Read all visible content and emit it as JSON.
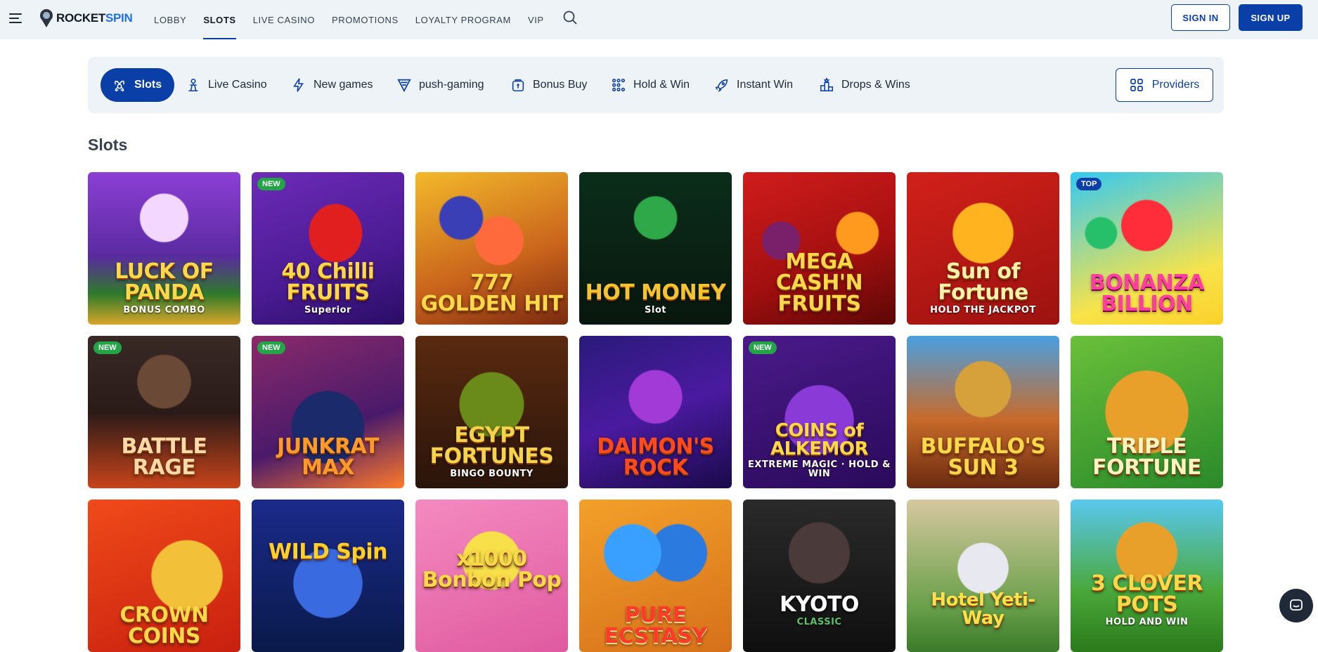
{
  "brand": {
    "part1": "ROCKET",
    "part2": "SPIN"
  },
  "nav": [
    {
      "label": "Lobby",
      "active": false
    },
    {
      "label": "Slots",
      "active": true
    },
    {
      "label": "Live Casino",
      "active": false
    },
    {
      "label": "Promotions",
      "active": false
    },
    {
      "label": "Loyalty Program",
      "active": false
    },
    {
      "label": "VIP",
      "active": false
    }
  ],
  "auth": {
    "signin": "SIGN IN",
    "signup": "SIGN UP"
  },
  "categories": [
    {
      "label": "Slots",
      "icon": "slots-icon"
    },
    {
      "label": "Live Casino",
      "icon": "live-casino-icon"
    },
    {
      "label": "New games",
      "icon": "lightning-icon"
    },
    {
      "label": "push-gaming",
      "icon": "push-gaming-icon"
    },
    {
      "label": "Bonus Buy",
      "icon": "bonus-buy-icon"
    },
    {
      "label": "Hold & Win",
      "icon": "hold-win-icon"
    },
    {
      "label": "Instant Win",
      "icon": "rocket-icon"
    },
    {
      "label": "Drops & Wins",
      "icon": "drops-wins-icon"
    }
  ],
  "providers_label": "Providers",
  "section_title": "Slots",
  "games": [
    {
      "title": "LUCK OF PANDA",
      "sub": "BONUS COMBO",
      "badge": ""
    },
    {
      "title": "40 Chilli FRUITS",
      "sub": "Superior",
      "badge": "NEW"
    },
    {
      "title": "777 GOLDEN HIT",
      "sub": "",
      "badge": ""
    },
    {
      "title": "HOT MONEY",
      "sub": "Slot",
      "badge": ""
    },
    {
      "title": "MEGA CASH'N FRUITS",
      "sub": "",
      "badge": ""
    },
    {
      "title": "Sun of Fortune",
      "sub": "HOLD THE JACKPOT",
      "badge": ""
    },
    {
      "title": "BONANZA BILLION",
      "sub": "",
      "badge": "TOP"
    },
    {
      "title": "BATTLE RAGE",
      "sub": "",
      "badge": "NEW"
    },
    {
      "title": "JUNKRAT MAX",
      "sub": "",
      "badge": "NEW"
    },
    {
      "title": "EGYPT FORTUNES",
      "sub": "BINGO BOUNTY",
      "badge": ""
    },
    {
      "title": "DAIMON'S ROCK",
      "sub": "",
      "badge": ""
    },
    {
      "title": "COINS of ALKEMOR",
      "sub": "EXTREME MAGIC · HOLD & WIN",
      "badge": "NEW"
    },
    {
      "title": "BUFFALO'S SUN 3",
      "sub": "",
      "badge": ""
    },
    {
      "title": "TRIPLE FORTUNE",
      "sub": "",
      "badge": ""
    },
    {
      "title": "CROWN COINS",
      "sub": "",
      "badge": ""
    },
    {
      "title": "WILD Spin",
      "sub": "",
      "badge": ""
    },
    {
      "title": "x1000 Bonbon Pop",
      "sub": "",
      "badge": ""
    },
    {
      "title": "PURE ECSTASY",
      "sub": "",
      "badge": ""
    },
    {
      "title": "KYOTO",
      "sub": "CLASSIC",
      "badge": ""
    },
    {
      "title": "Hotel Yeti-Way",
      "sub": "",
      "badge": ""
    },
    {
      "title": "3 CLOVER POTS",
      "sub": "HOLD AND WIN",
      "badge": ""
    }
  ],
  "colors": {
    "primary": "#0b3fa8",
    "header_bg": "#eef3f8",
    "new_badge": "#22a447"
  }
}
